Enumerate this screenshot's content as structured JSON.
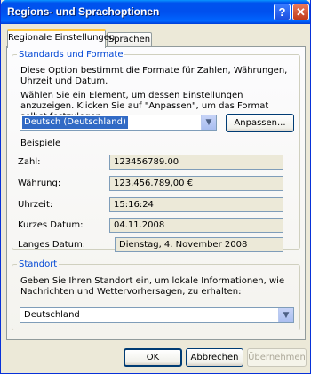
{
  "window": {
    "title": "Regions- und Sprachoptionen",
    "help_glyph": "?",
    "close_glyph": "✕"
  },
  "tabs": [
    {
      "label": "Regionale Einstellungen",
      "active": true
    },
    {
      "label": "Sprachen",
      "active": false
    }
  ],
  "standards": {
    "group_title": "Standards und Formate",
    "description": "Diese Option bestimmt die Formate für Zahlen, Währungen, Uhrzeit und Datum.",
    "instruction": "Wählen Sie ein Element, um dessen Einstellungen anzuzeigen. Klicken Sie auf \"Anpassen\", um das Format selbst festzulegen:",
    "selected_format": "Deutsch (Deutschland)",
    "customize_label": "Anpassen...",
    "examples_heading": "Beispiele",
    "examples": [
      {
        "label": "Zahl:",
        "value": "123456789.00"
      },
      {
        "label": "Währung:",
        "value": "123.456.789,00 €"
      },
      {
        "label": "Uhrzeit:",
        "value": "15:16:24"
      },
      {
        "label": "Kurzes Datum:",
        "value": "04.11.2008"
      },
      {
        "label": "Langes Datum:",
        "value": "Dienstag, 4. November 2008"
      }
    ]
  },
  "location": {
    "group_title": "Standort",
    "description": "Geben Sie Ihren Standort ein, um lokale Informationen, wie Nachrichten und Wettervorhersagen, zu erhalten:",
    "selected_location": "Deutschland"
  },
  "footer": {
    "ok_label": "OK",
    "cancel_label": "Abbrechen",
    "apply_label": "Übernehmen"
  },
  "icons": {
    "dropdown_arrow": "chevron-down-icon"
  },
  "colors": {
    "titlebar": "#0053ee",
    "group_title": "#0046d5",
    "selection": "#316ac5",
    "dialog_bg": "#ece9d8"
  }
}
